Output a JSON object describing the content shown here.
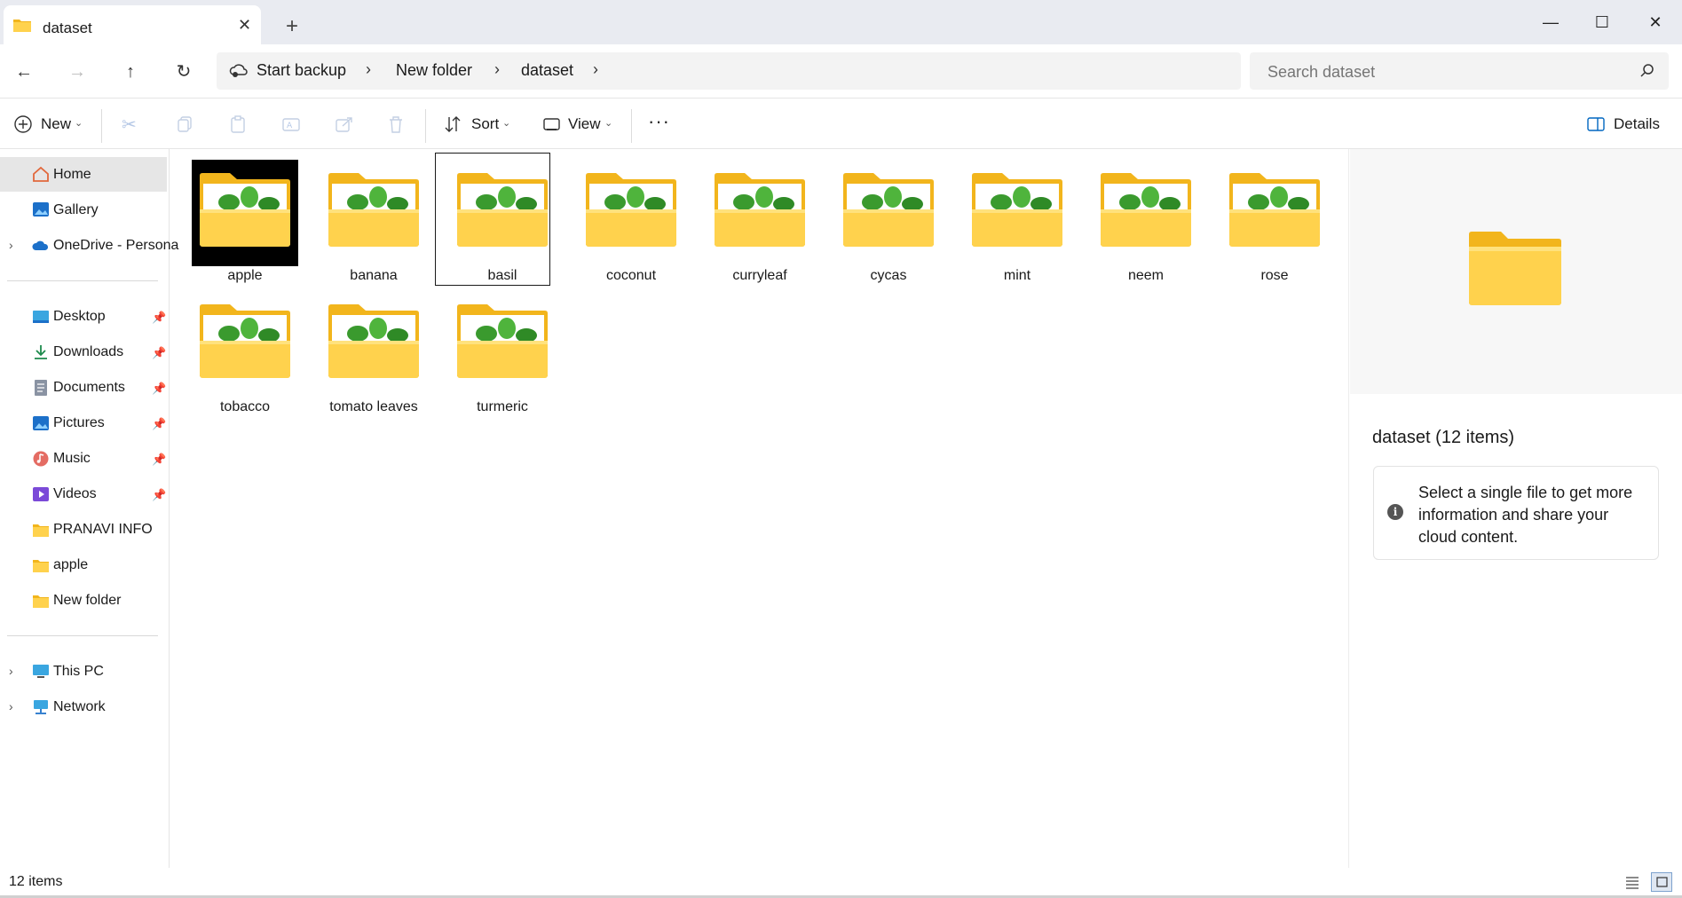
{
  "tab": {
    "title": "dataset"
  },
  "nav": {
    "breadcrumbs": [
      "Start backup",
      "New folder",
      "dataset"
    ],
    "search_placeholder": "Search dataset"
  },
  "commands": {
    "new": "New",
    "sort": "Sort",
    "view": "View",
    "details": "Details"
  },
  "sidebar": {
    "home": "Home",
    "gallery": "Gallery",
    "onedrive": "OneDrive - Persona",
    "quick": [
      {
        "label": "Desktop",
        "icon": "desktop-icon"
      },
      {
        "label": "Downloads",
        "icon": "download-icon"
      },
      {
        "label": "Documents",
        "icon": "documents-icon"
      },
      {
        "label": "Pictures",
        "icon": "pictures-icon"
      },
      {
        "label": "Music",
        "icon": "music-icon"
      },
      {
        "label": "Videos",
        "icon": "videos-icon"
      },
      {
        "label": "PRANAVI INFO",
        "icon": "folder-icon"
      },
      {
        "label": "apple",
        "icon": "folder-icon"
      },
      {
        "label": "New folder",
        "icon": "folder-icon"
      }
    ],
    "this_pc": "This PC",
    "network": "Network"
  },
  "folders": [
    "apple",
    "banana",
    "basil",
    "coconut",
    "curryleaf",
    "cycas",
    "mint",
    "neem",
    "rose",
    "tobacco",
    "tomato leaves",
    "turmeric"
  ],
  "details": {
    "title": "dataset (12 items)",
    "info": "Select a single file to get more information and share your cloud content."
  },
  "status": {
    "count": "12 items"
  },
  "colors": {
    "folder_back": "#f2b51c",
    "folder_front": "#ffd24d",
    "leaf": "#3a9a2e",
    "accent": "#0067c0"
  }
}
